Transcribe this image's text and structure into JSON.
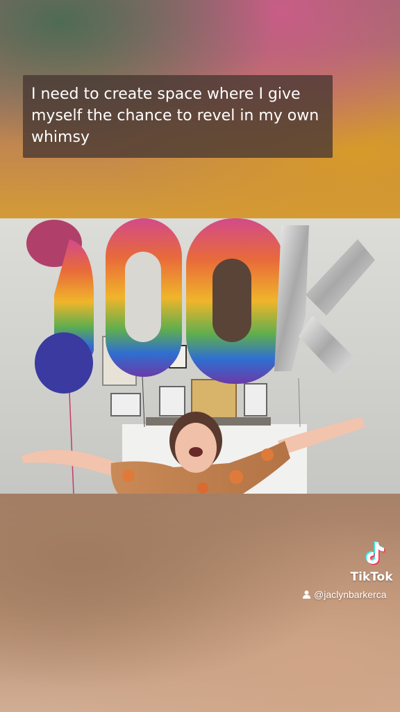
{
  "caption": {
    "text": "I need to create space where I give myself the chance to revel in my own whimsy"
  },
  "video": {
    "balloons": [
      "1",
      "0",
      "0",
      "K"
    ]
  },
  "watermark": {
    "brand": "TikTok",
    "handle": "@jaclynbarkerca",
    "icon": "tiktok-note-icon",
    "user_icon": "user-icon"
  }
}
